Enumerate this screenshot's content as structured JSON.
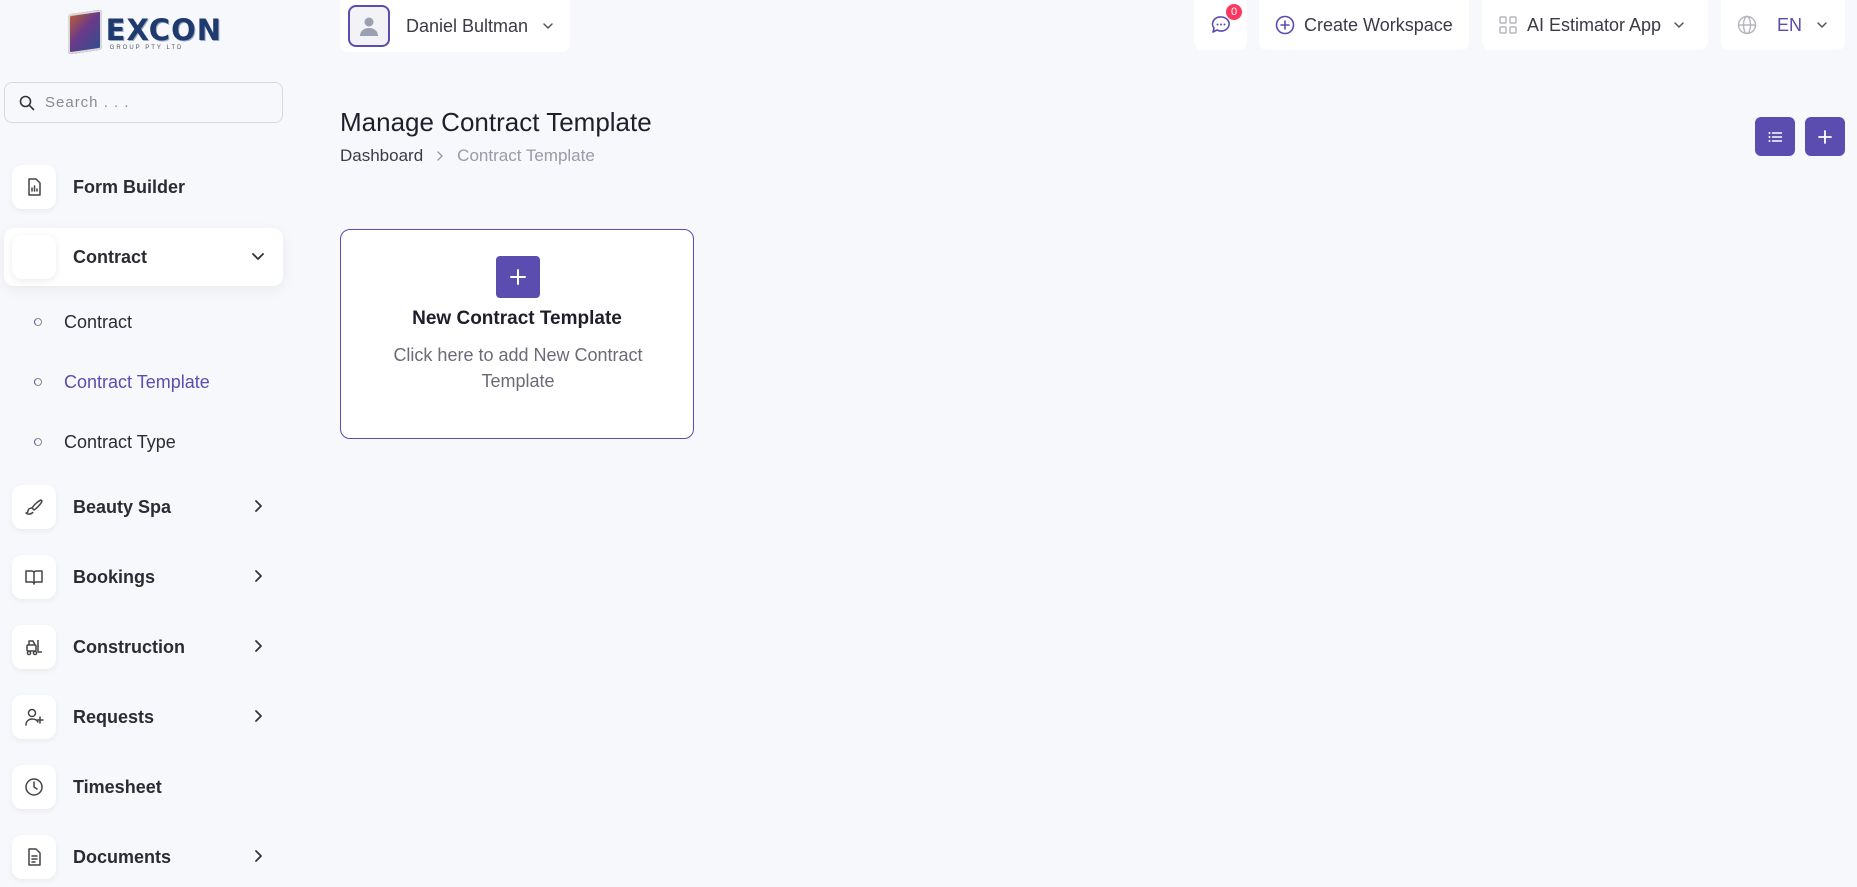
{
  "brand": {
    "name": "EXCON",
    "tagline": "GROUP PTY LTD"
  },
  "search": {
    "placeholder": "Search . . ."
  },
  "sidebar": {
    "items": [
      {
        "label": "Form Builder"
      },
      {
        "label": "Contract"
      },
      {
        "label": "Beauty Spa"
      },
      {
        "label": "Bookings"
      },
      {
        "label": "Construction"
      },
      {
        "label": "Requests"
      },
      {
        "label": "Timesheet"
      },
      {
        "label": "Documents"
      }
    ],
    "contract_sub": [
      {
        "label": "Contract"
      },
      {
        "label": "Contract Template"
      },
      {
        "label": "Contract Type"
      }
    ]
  },
  "topbar": {
    "user_name": "Daniel Bultman",
    "messages_count": "0",
    "create_workspace": "Create Workspace",
    "app_switch": "AI Estimator App",
    "language": "EN"
  },
  "page": {
    "title": "Manage Contract Template",
    "breadcrumb_home": "Dashboard",
    "breadcrumb_current": "Contract Template"
  },
  "card": {
    "title": "New Contract Template",
    "description": "Click here to add New Contract Template"
  },
  "colors": {
    "accent": "#5b4cb0",
    "badge": "#ff3860",
    "background": "#f7f8fc"
  }
}
